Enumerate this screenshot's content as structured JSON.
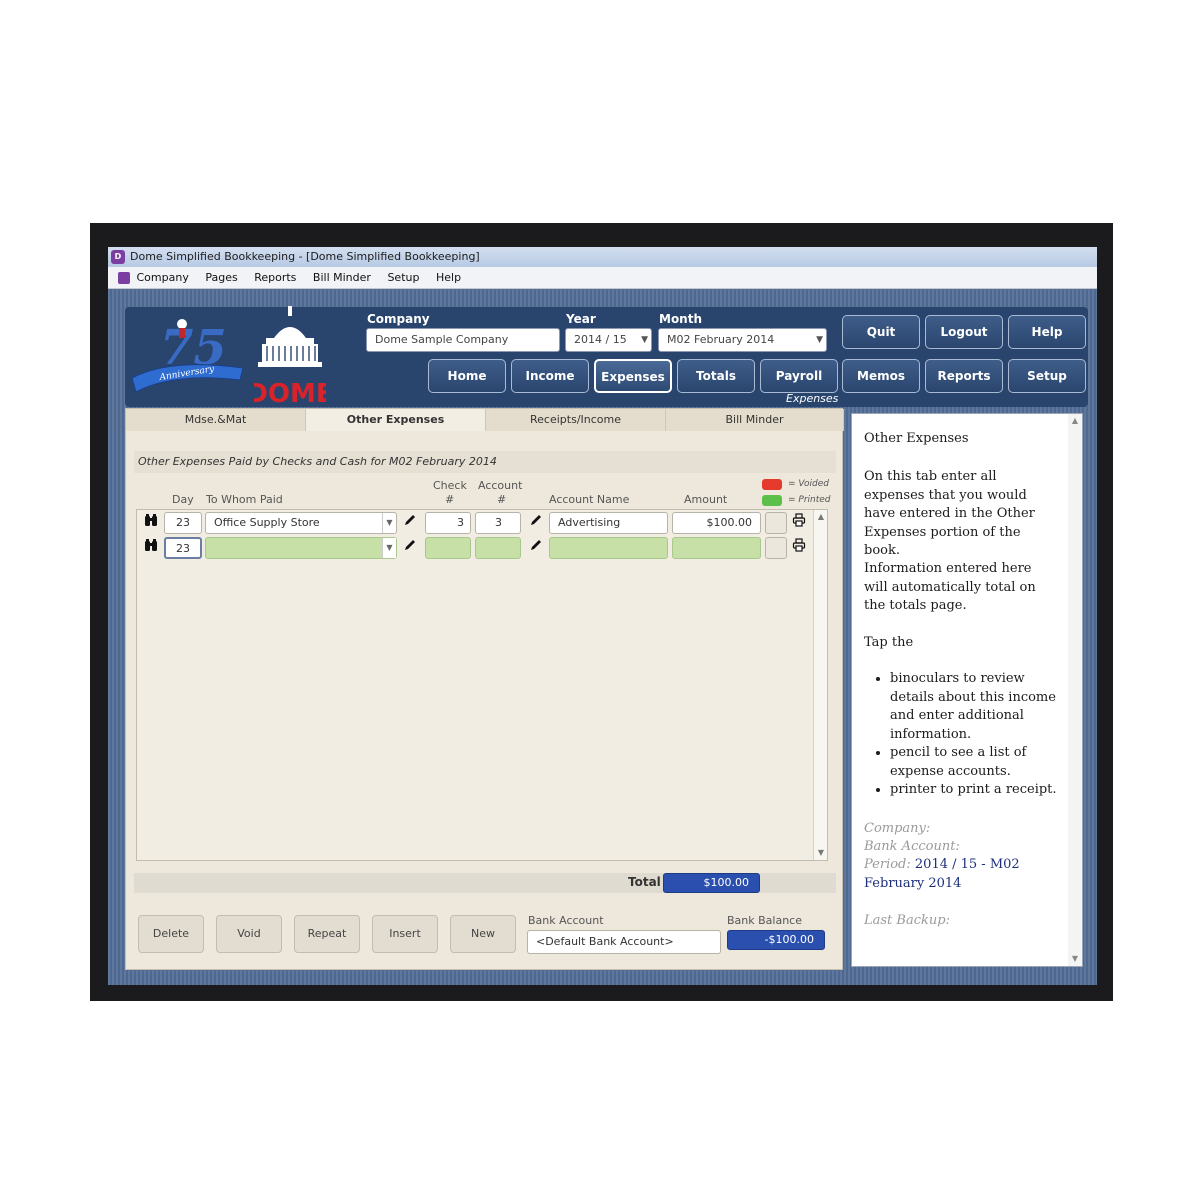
{
  "window": {
    "title": "Dome Simplified Bookkeeping - [Dome Simplified Bookkeeping]"
  },
  "menu": [
    "Company",
    "Pages",
    "Reports",
    "Bill Minder",
    "Setup",
    "Help"
  ],
  "header": {
    "company_label": "Company",
    "company_value": "Dome Sample Company",
    "year_label": "Year",
    "year_value": "2014 / 15",
    "month_label": "Month",
    "month_value": "M02 February 2014",
    "nav": {
      "home": "Home",
      "income": "Income",
      "expenses": "Expenses",
      "totals": "Totals",
      "payroll": "Payroll",
      "memos": "Memos",
      "reports": "Reports",
      "setup": "Setup",
      "quit": "Quit",
      "logout": "Logout",
      "help": "Help"
    },
    "current_page": "Expenses",
    "logo_text": "DOME",
    "anniversary_text": "Anniversary",
    "anniversary_number": "75"
  },
  "tabs": [
    "Mdse.&Mat",
    "Other Expenses",
    "Receipts/Income",
    "Bill Minder"
  ],
  "section_title": "Other Expenses Paid by Checks and Cash for M02 February 2014",
  "columns": {
    "day": "Day",
    "to_whom": "To Whom Paid",
    "check": "Check",
    "check_hash": "#",
    "account": "Account",
    "account_hash": "#",
    "account_name": "Account Name",
    "amount": "Amount"
  },
  "legend": {
    "voided": "= Voided",
    "printed": "= Printed",
    "voided_color": "#e53b2c",
    "printed_color": "#5cbf4a"
  },
  "rows": [
    {
      "day": "23",
      "to_whom": "Office Supply Store",
      "check": "3",
      "account": "3",
      "account_name": "Advertising",
      "amount": "$100.00"
    },
    {
      "day": "23",
      "to_whom": "",
      "check": "",
      "account": "",
      "account_name": "",
      "amount": ""
    }
  ],
  "totals": {
    "label": "Total",
    "value": "$100.00"
  },
  "buttons": {
    "delete": "Delete",
    "void": "Void",
    "repeat": "Repeat",
    "insert": "Insert",
    "new": "New"
  },
  "bank": {
    "account_label": "Bank Account",
    "account_value": "<Default Bank Account>",
    "balance_label": "Bank Balance",
    "balance_value": "-$100.00"
  },
  "help": {
    "title": "Other Expenses",
    "p1": "On this tab enter all expenses that you would have entered in the Other Expenses portion of the book.",
    "p2": "Information entered here will automatically total on the totals page.",
    "p3": "Tap the",
    "bullets": [
      "binoculars to review details about this income and enter additional information.",
      "pencil to see a list of expense accounts.",
      "printer to print a receipt."
    ],
    "company_label": "Company:",
    "bank_label": "Bank Account:",
    "period_label": "Period:",
    "period_value": "2014 / 15 - M02 February 2014",
    "backup_label": "Last Backup:"
  },
  "colors": {
    "header_blue": "#29456e",
    "total_blue": "#2a4fae",
    "new_row_green": "#c6e0a8"
  }
}
